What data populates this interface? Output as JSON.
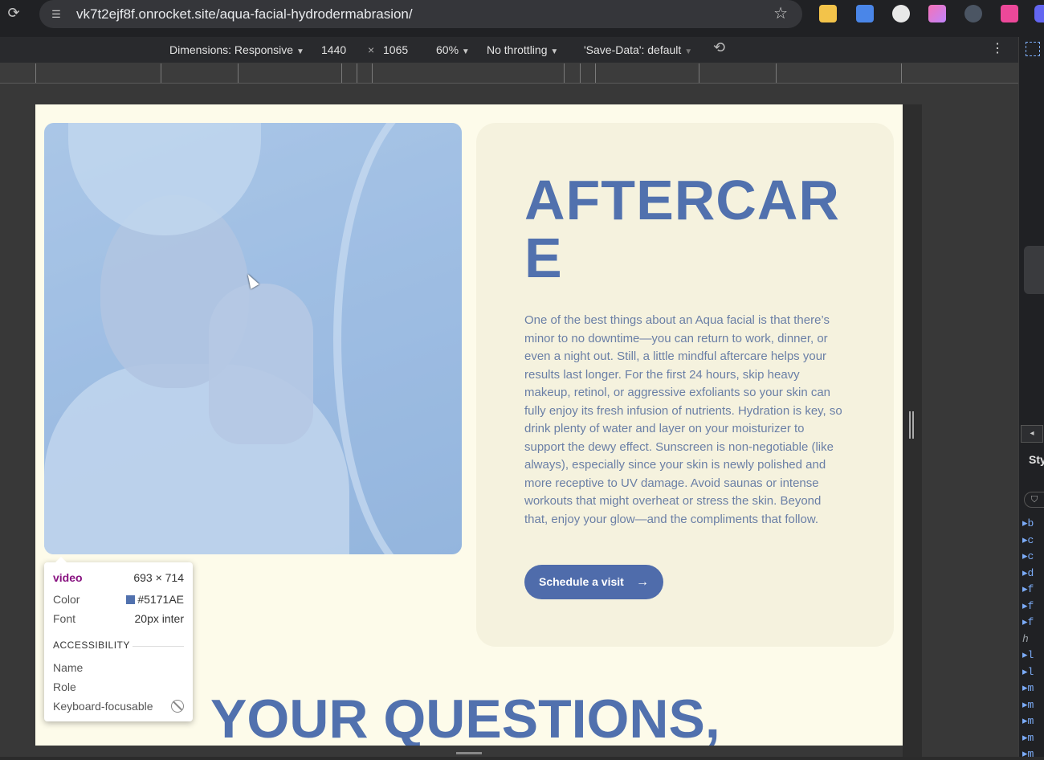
{
  "browser": {
    "url": "vk7t2ejf8f.onrocket.site/aqua-facial-hydrodermabrasion/"
  },
  "device_toolbar": {
    "dimensions_label": "Dimensions: Responsive",
    "width": "1440",
    "times": "×",
    "height": "1065",
    "zoom": "60%",
    "throttling": "No throttling",
    "save_data": "'Save-Data': default"
  },
  "page": {
    "title": "AFTERCARE",
    "body": "One of the best things about an Aqua facial is that there’s minor to no downtime—you can return to work, dinner, or even a night out. Still, a little mindful aftercare helps your results last longer. For the first 24 hours, skip heavy makeup, retinol, or aggressive exfoliants so your skin can fully enjoy its fresh infusion of nutrients. Hydration is key, so drink plenty of water and layer on your moisturizer to support the dewy effect. Sunscreen is non-negotiable (like always), especially since your skin is newly polished and more receptive to UV damage. Avoid saunas or intense workouts that might overheat or stress the skin. Beyond that, enjoy your glow—and the compliments that follow.",
    "cta_label": "Schedule a visit",
    "cta_arrow": "→",
    "next_heading": "YOUR QUESTIONS,"
  },
  "inspector_tooltip": {
    "tag": "video",
    "size": "693 × 714",
    "color_label": "Color",
    "color_value": "#5171AE",
    "font_label": "Font",
    "font_value": "20px inter",
    "section": "ACCESSIBILITY",
    "name_label": "Name",
    "role_label": "Role",
    "keyboard_label": "Keyboard-focusable"
  },
  "side_panel": {
    "styles_tab": "Sty",
    "items": [
      "b",
      "c",
      "c",
      "d",
      "f",
      "f",
      "f",
      "h",
      "l",
      "l",
      "m",
      "m",
      "m",
      "m",
      "m"
    ]
  },
  "colors": {
    "brand_blue": "#5171AE",
    "cream_bg": "#FDFBEA",
    "card_bg": "#F5F2DE"
  }
}
